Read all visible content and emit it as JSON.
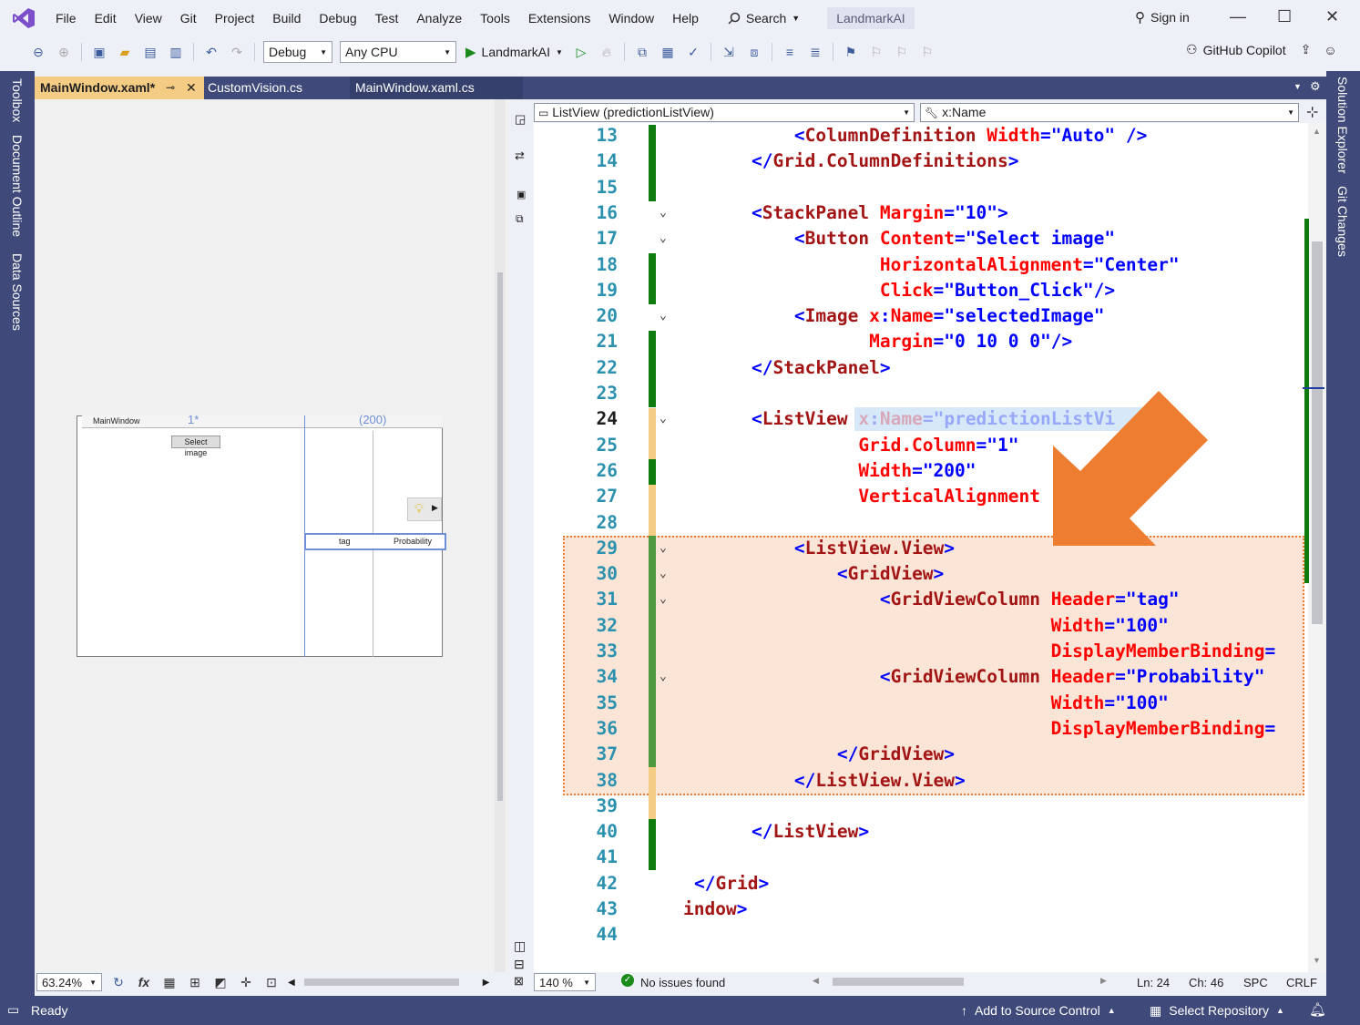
{
  "menubar": {
    "items": [
      "File",
      "Edit",
      "View",
      "Git",
      "Project",
      "Build",
      "Debug",
      "Test",
      "Analyze",
      "Tools",
      "Extensions",
      "Window",
      "Help"
    ],
    "search_label": "Search",
    "solution_name": "LandmarkAI",
    "sign_in": "Sign in"
  },
  "toolbar": {
    "config": "Debug",
    "platform": "Any CPU",
    "run_target": "LandmarkAI",
    "copilot": "GitHub Copilot"
  },
  "left_tabs": [
    "Toolbox",
    "Document Outline",
    "Data Sources"
  ],
  "right_tabs": [
    "Solution Explorer",
    "Git Changes"
  ],
  "tabs": [
    {
      "label": "MainWindow.xaml*",
      "active": true
    },
    {
      "label": "CustomVision.cs",
      "active": false
    },
    {
      "label": "MainWindow.xaml.cs",
      "active": false
    }
  ],
  "designer": {
    "window_title": "MainWindow",
    "col1": "1*",
    "col2": "(200)",
    "button": "Select image",
    "header_tag": "tag",
    "header_prob": "Probability",
    "zoom": "63.24%"
  },
  "nav": {
    "left": "ListView (predictionListView)",
    "right": "x:Name"
  },
  "code_lines": [
    {
      "n": "13",
      "tokens": [
        [
          "pun",
          "        <"
        ],
        [
          "tag",
          "ColumnDefinition "
        ],
        [
          "att",
          "Width"
        ],
        [
          "pun",
          "="
        ],
        [
          "val",
          "\"Auto\""
        ],
        [
          "pun",
          " />"
        ]
      ]
    },
    {
      "n": "14",
      "tokens": [
        [
          "pun",
          "    </"
        ],
        [
          "tag",
          "Grid.ColumnDefinitions"
        ],
        [
          "pun",
          ">"
        ]
      ]
    },
    {
      "n": "15",
      "tokens": []
    },
    {
      "n": "16",
      "tokens": [
        [
          "pun",
          "    <"
        ],
        [
          "tag",
          "StackPanel "
        ],
        [
          "att",
          "Margin"
        ],
        [
          "pun",
          "="
        ],
        [
          "val",
          "\"10\""
        ],
        [
          "pun",
          ">"
        ]
      ]
    },
    {
      "n": "17",
      "tokens": [
        [
          "pun",
          "        <"
        ],
        [
          "tag",
          "Button "
        ],
        [
          "att",
          "Content"
        ],
        [
          "pun",
          "="
        ],
        [
          "val",
          "\"Select image\""
        ]
      ]
    },
    {
      "n": "18",
      "tokens": [
        [
          "att",
          "                HorizontalAlignment"
        ],
        [
          "pun",
          "="
        ],
        [
          "val",
          "\"Center\""
        ]
      ]
    },
    {
      "n": "19",
      "tokens": [
        [
          "att",
          "                Click"
        ],
        [
          "pun",
          "="
        ],
        [
          "val",
          "\"Button_Click\""
        ],
        [
          "pun",
          "/>"
        ]
      ]
    },
    {
      "n": "20",
      "tokens": [
        [
          "pun",
          "        <"
        ],
        [
          "tag",
          "Image "
        ],
        [
          "att",
          "x"
        ],
        [
          "pun",
          ":"
        ],
        [
          "att",
          "Name"
        ],
        [
          "pun",
          "="
        ],
        [
          "val",
          "\"selectedImage\""
        ]
      ]
    },
    {
      "n": "21",
      "tokens": [
        [
          "att",
          "               Margin"
        ],
        [
          "pun",
          "="
        ],
        [
          "val",
          "\"0 10 0 0\""
        ],
        [
          "pun",
          "/>"
        ]
      ]
    },
    {
      "n": "22",
      "tokens": [
        [
          "pun",
          "    </"
        ],
        [
          "tag",
          "StackPanel"
        ],
        [
          "pun",
          ">"
        ]
      ]
    },
    {
      "n": "23",
      "tokens": []
    },
    {
      "n": "24",
      "tokens": [
        [
          "pun",
          "    <"
        ],
        [
          "tag",
          "ListView "
        ],
        [
          "att",
          "x"
        ],
        [
          "pun",
          ":"
        ],
        [
          "att",
          "Name"
        ],
        [
          "pun",
          "="
        ],
        [
          "val",
          "\"predictionListVi"
        ]
      ]
    },
    {
      "n": "25",
      "tokens": [
        [
          "att",
          "              Grid.Column"
        ],
        [
          "pun",
          "="
        ],
        [
          "val",
          "\"1\""
        ]
      ]
    },
    {
      "n": "26",
      "tokens": [
        [
          "att",
          "              Width"
        ],
        [
          "pun",
          "="
        ],
        [
          "val",
          "\"200\""
        ]
      ]
    },
    {
      "n": "27",
      "tokens": [
        [
          "att",
          "              VerticalAlignment"
        ]
      ]
    },
    {
      "n": "28",
      "tokens": []
    },
    {
      "n": "29",
      "tokens": [
        [
          "pun",
          "        <"
        ],
        [
          "tag",
          "ListView.View"
        ],
        [
          "pun",
          ">"
        ]
      ]
    },
    {
      "n": "30",
      "tokens": [
        [
          "pun",
          "            <"
        ],
        [
          "tag",
          "GridView"
        ],
        [
          "pun",
          ">"
        ]
      ]
    },
    {
      "n": "31",
      "tokens": [
        [
          "pun",
          "                <"
        ],
        [
          "tag",
          "GridViewColumn "
        ],
        [
          "att",
          "Header"
        ],
        [
          "pun",
          "="
        ],
        [
          "val",
          "\"tag\""
        ]
      ]
    },
    {
      "n": "32",
      "tokens": [
        [
          "att",
          "                                Width"
        ],
        [
          "pun",
          "="
        ],
        [
          "val",
          "\"100\""
        ]
      ]
    },
    {
      "n": "33",
      "tokens": [
        [
          "att",
          "                                DisplayMemberBinding"
        ],
        [
          "pun",
          "="
        ]
      ]
    },
    {
      "n": "34",
      "tokens": [
        [
          "pun",
          "                <"
        ],
        [
          "tag",
          "GridViewColumn "
        ],
        [
          "att",
          "Header"
        ],
        [
          "pun",
          "="
        ],
        [
          "val",
          "\"Probability\""
        ]
      ]
    },
    {
      "n": "35",
      "tokens": [
        [
          "att",
          "                                Width"
        ],
        [
          "pun",
          "="
        ],
        [
          "val",
          "\"100\""
        ]
      ]
    },
    {
      "n": "36",
      "tokens": [
        [
          "att",
          "                                DisplayMemberBinding"
        ],
        [
          "pun",
          "="
        ]
      ]
    },
    {
      "n": "37",
      "tokens": [
        [
          "pun",
          "            </"
        ],
        [
          "tag",
          "GridView"
        ],
        [
          "pun",
          ">"
        ]
      ]
    },
    {
      "n": "38",
      "tokens": [
        [
          "pun",
          "        </"
        ],
        [
          "tag",
          "ListView.View"
        ],
        [
          "pun",
          ">"
        ]
      ]
    },
    {
      "n": "39",
      "tokens": []
    },
    {
      "n": "40",
      "tokens": [
        [
          "pun",
          "    </"
        ],
        [
          "tag",
          "ListView"
        ],
        [
          "pun",
          ">"
        ]
      ]
    },
    {
      "n": "41",
      "tokens": []
    },
    {
      "n": "42",
      "tokens": [
        [
          "pun",
          "</"
        ],
        [
          "tag",
          "Grid"
        ],
        [
          "pun",
          ">"
        ]
      ]
    },
    {
      "n": "43",
      "tokens": [
        [
          "tag",
          "indow"
        ],
        [
          "pun",
          ">"
        ]
      ]
    },
    {
      "n": "44",
      "tokens": []
    }
  ],
  "editor_status": {
    "zoom": "140 %",
    "issues": "No issues found",
    "ln": "Ln: 24",
    "ch": "Ch: 46",
    "spc": "SPC",
    "eol": "CRLF"
  },
  "statusbar": {
    "ready": "Ready",
    "source_control": "Add to Source Control",
    "repository": "Select Repository"
  },
  "colors": {
    "accent_purple": "#3f4a7a",
    "arrow": "#ed7d31",
    "highlight_bg": "#fbe5d6",
    "change_green": "#107c10",
    "tab_active": "#f5cc84"
  }
}
